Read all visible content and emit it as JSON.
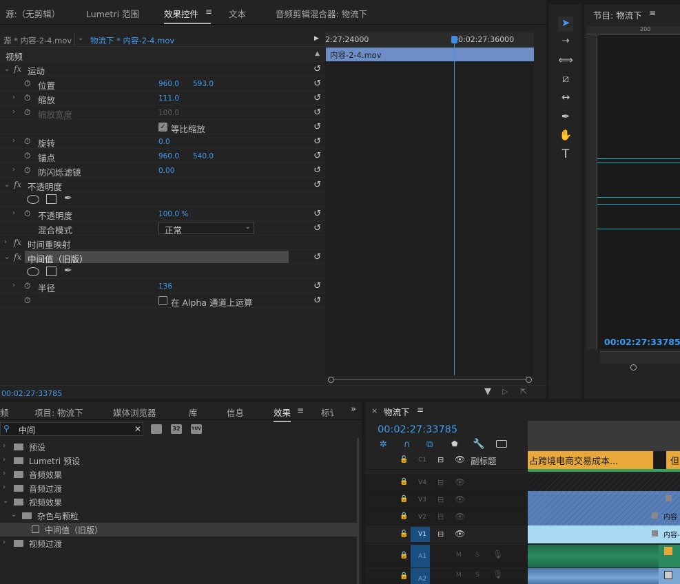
{
  "top_tabs": {
    "source": "源:（无剪辑）",
    "lumetri": "Lumetri 范围",
    "effect_controls": "效果控件",
    "text": "文本",
    "audio_mixer": "音频剪辑混合器: 物流下"
  },
  "clip_selector": {
    "master": "源 * 内容-2-4.mov",
    "sequence": "物流下 * 内容-2-4.mov"
  },
  "mini_timeline": {
    "ts1": "2:27:24000",
    "ts2": "00:02:27:36000",
    "clip": "内容-2-4.mov"
  },
  "video_header": "视频",
  "effects": {
    "motion": {
      "name": "运动",
      "position_label": "位置",
      "position_x": "960.0",
      "position_y": "593.0",
      "scale_label": "缩放",
      "scale": "111.0",
      "scale_width_label": "缩放宽度",
      "scale_width": "100.0",
      "uniform_label": "等比缩放",
      "rotation_label": "旋转",
      "rotation": "0.0",
      "anchor_label": "锚点",
      "anchor_x": "960.0",
      "anchor_y": "540.0",
      "flicker_label": "防闪烁滤镜",
      "flicker": "0.00"
    },
    "opacity": {
      "name": "不透明度",
      "opacity_label": "不透明度",
      "opacity": "100.0 %",
      "blend_label": "混合模式",
      "blend": "正常"
    },
    "time_remap": {
      "name": "时间重映射"
    },
    "median": {
      "name": "中间值（旧版）",
      "radius_label": "半径",
      "radius": "136",
      "alpha_label": "在 Alpha 通道上运算"
    }
  },
  "ec_timecode": "00:02:27:33785",
  "program": {
    "title": "节目: 物流下",
    "timecode": "00:02:27:33785",
    "ruler": "200"
  },
  "project_tabs": {
    "t0": "频",
    "t1": "项目: 物流下",
    "t2": "媒体浏览器",
    "t3": "库",
    "t4": "信息",
    "t5": "效果",
    "t6": "标讠"
  },
  "effects_panel": {
    "search_value": "中间",
    "badge1": "32",
    "badge2": "YUV",
    "tree": [
      "预设",
      "Lumetri 预设",
      "音频效果",
      "音频过渡",
      "视频效果",
      "杂色与颗粒",
      "中间值（旧版）",
      "视频过渡"
    ]
  },
  "timeline": {
    "title": "物流下",
    "timecode": "00:02:27:33785",
    "subtitle_label": "副标题",
    "caption_clip": "占跨境电商交易成本...",
    "caption_clip2": "但",
    "tracks": {
      "c1": "C1",
      "v4": "V4",
      "v3": "V3",
      "v2": "V2",
      "v1": "V1",
      "a1": "A1",
      "a2": "A2",
      "m": "M",
      "s": "S"
    },
    "clip_v2": "内容",
    "clip_v1": "内容-"
  }
}
